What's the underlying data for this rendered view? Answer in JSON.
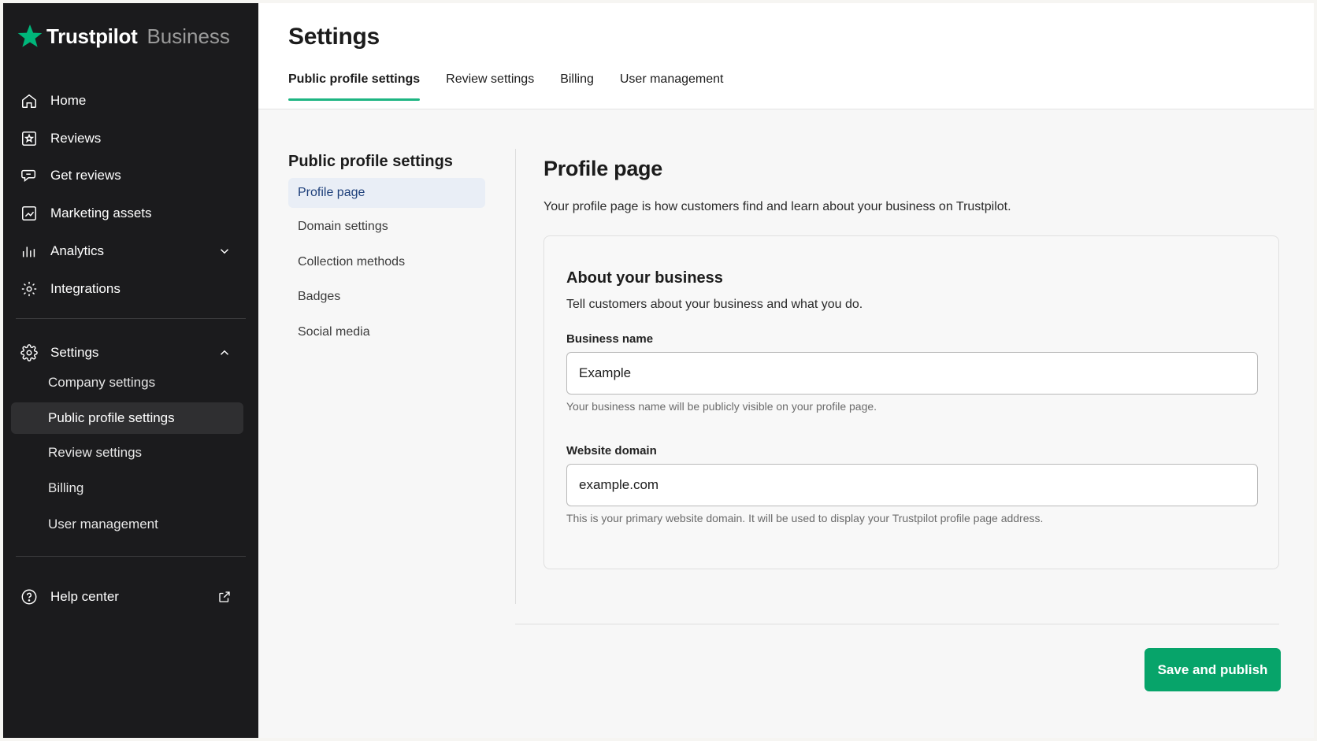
{
  "brand": {
    "name": "Trustpilot",
    "product": "Business",
    "accent_color": "#00b67a"
  },
  "sidebar": {
    "main_items": [
      {
        "label": "Home",
        "icon": "home-icon"
      },
      {
        "label": "Reviews",
        "icon": "reviews-icon"
      },
      {
        "label": "Get reviews",
        "icon": "get-reviews-icon"
      },
      {
        "label": "Marketing assets",
        "icon": "marketing-assets-icon"
      },
      {
        "label": "Analytics",
        "icon": "analytics-icon"
      },
      {
        "label": "Integrations",
        "icon": "integrations-icon"
      }
    ],
    "settings": {
      "label": "Settings",
      "sub_items": [
        {
          "label": "Company settings"
        },
        {
          "label": "Public profile settings",
          "active": true
        },
        {
          "label": "Review settings"
        },
        {
          "label": "Billing"
        },
        {
          "label": "User management"
        }
      ]
    },
    "help": {
      "label": "Help center"
    }
  },
  "header": {
    "title": "Settings",
    "tabs": [
      {
        "label": "Public profile settings",
        "active": true
      },
      {
        "label": "Review settings"
      },
      {
        "label": "Billing"
      },
      {
        "label": "User management"
      }
    ]
  },
  "subnav": {
    "title": "Public profile settings",
    "items": [
      {
        "label": "Profile page",
        "active": true
      },
      {
        "label": "Domain settings"
      },
      {
        "label": "Collection methods"
      },
      {
        "label": "Badges"
      },
      {
        "label": "Social media"
      }
    ]
  },
  "content": {
    "title": "Profile page",
    "description": "Your profile page is how customers find and learn about your business on Trustpilot.",
    "card": {
      "title": "About your business",
      "description": "Tell customers about your business and what you do.",
      "business_name": {
        "label": "Business name",
        "value": "Example",
        "help": "Your business name will be publicly visible on your profile page."
      },
      "website_domain": {
        "label": "Website domain",
        "value": "example.com",
        "help": "This is your primary website domain. It will be used to display your Trustpilot profile page address."
      }
    },
    "save_button": "Save and publish",
    "save_button_color": "#07a46a"
  }
}
